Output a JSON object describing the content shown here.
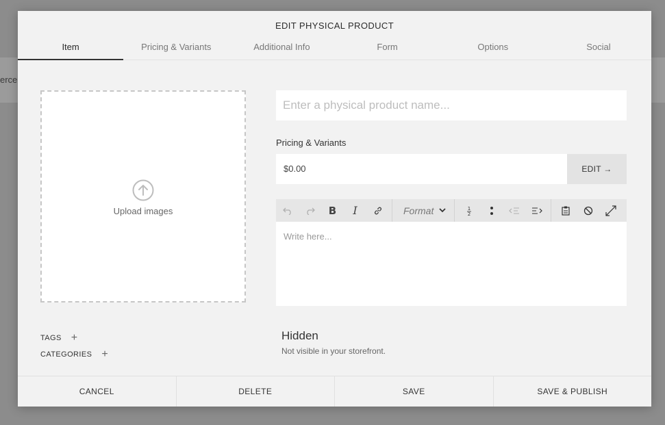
{
  "background": {
    "partial_text": "erce"
  },
  "modal": {
    "title": "EDIT PHYSICAL PRODUCT",
    "tabs": [
      {
        "label": "Item",
        "active": true
      },
      {
        "label": "Pricing & Variants",
        "active": false
      },
      {
        "label": "Additional Info",
        "active": false
      },
      {
        "label": "Form",
        "active": false
      },
      {
        "label": "Options",
        "active": false
      },
      {
        "label": "Social",
        "active": false
      }
    ]
  },
  "upload": {
    "label": "Upload images",
    "icon": "upload-arrow-circle-icon"
  },
  "product_name": {
    "placeholder": "Enter a physical product name...",
    "value": ""
  },
  "pricing": {
    "label": "Pricing & Variants",
    "price": "$0.00",
    "edit_label": "EDIT →"
  },
  "editor": {
    "toolbar": {
      "format_label": "Format",
      "buttons": [
        "undo-icon",
        "redo-icon",
        "bold-icon",
        "italic-icon",
        "link-icon",
        "ordered-list-icon",
        "unordered-list-icon",
        "outdent-icon",
        "indent-icon",
        "paste-icon",
        "clear-format-icon",
        "fullscreen-icon"
      ]
    },
    "placeholder": "Write here..."
  },
  "tags": {
    "label": "TAGS"
  },
  "categories": {
    "label": "CATEGORIES"
  },
  "visibility": {
    "title": "Hidden",
    "subtitle": "Not visible in your storefront."
  },
  "footer": {
    "cancel": "CANCEL",
    "delete": "DELETE",
    "save": "SAVE",
    "save_publish": "SAVE & PUBLISH"
  },
  "colors": {
    "modal_bg": "#f2f2f2",
    "overlay": "#8c8c8c",
    "toolbar_bg": "#e6e6e6"
  }
}
